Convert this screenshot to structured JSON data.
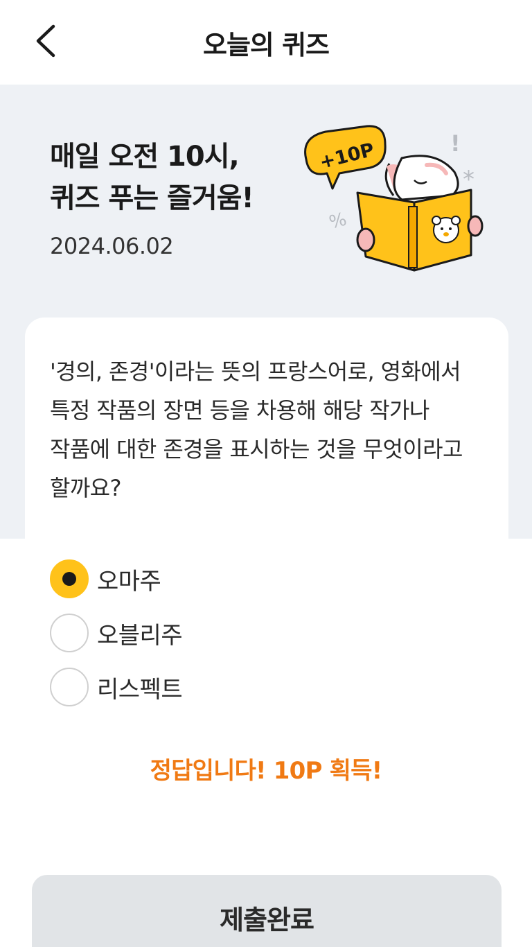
{
  "header": {
    "title": "오늘의 퀴즈",
    "back_icon": "chevron-left-icon"
  },
  "hero": {
    "title_line1": "매일 오전 10시,",
    "title_line2": "퀴즈 푸는 즐거움!",
    "date": "2024.06.02",
    "badge": "+10P",
    "illustration": "rabbit-reading-book-icon"
  },
  "quiz": {
    "question": "'경의, 존경'이라는 뜻의 프랑스어로, 영화에서 특정 작품의 장면 등을 차용해 해당 작가나 작품에 대한 존경을 표시하는 것을 무엇이라고 할까요?",
    "options": [
      {
        "label": "오마주",
        "selected": true
      },
      {
        "label": "오블리주",
        "selected": false
      },
      {
        "label": "리스펙트",
        "selected": false
      }
    ],
    "result": "정답입니다! 10P 획득!"
  },
  "submit": {
    "label": "제출완료"
  },
  "colors": {
    "accent": "#ffc21a",
    "result": "#f07a14",
    "hero_bg": "#eef1f5",
    "button_bg": "#e1e4e7"
  }
}
